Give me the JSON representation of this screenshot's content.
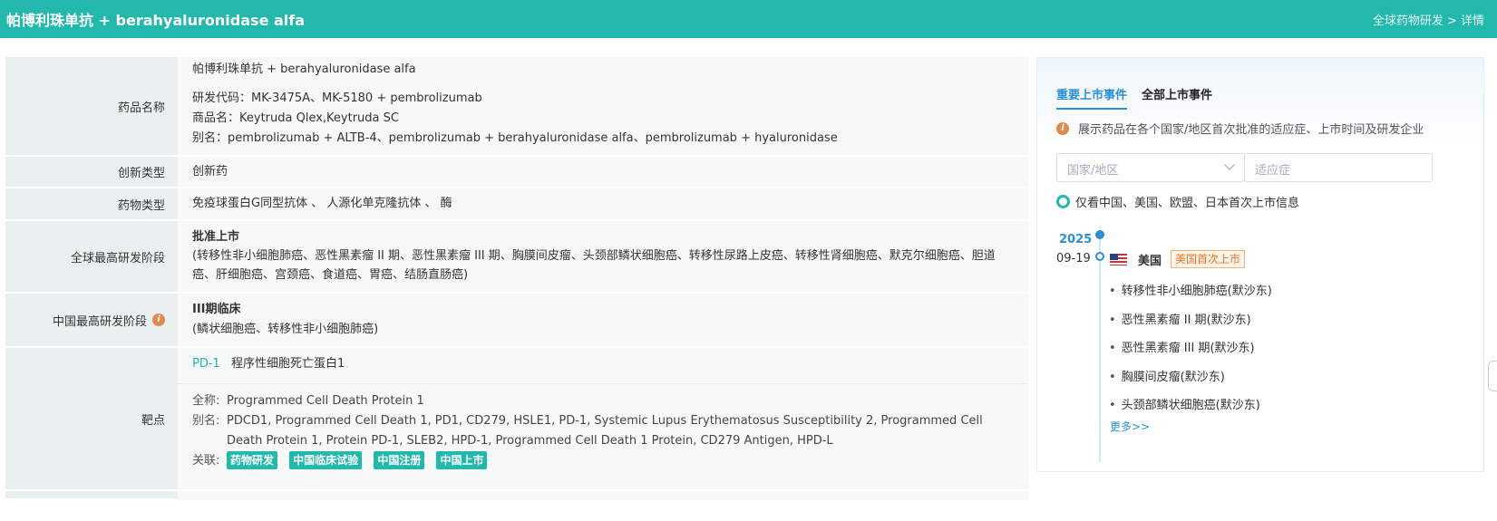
{
  "header": {
    "title": "帕博利珠单抗 + berahyaluronidase alfa",
    "breadcrumb": "全球药物研发 > 详情"
  },
  "table": {
    "drug_name": {
      "label": "药品名称",
      "name": "帕博利珠单抗 + berahyaluronidase alfa",
      "dev_code": "研发代码：MK-3475A、MK-5180 + pembrolizumab",
      "trade_name": "商品名：Keytruda Qlex,Keytruda SC",
      "alias": "别名：pembrolizumab + ALTB-4、pembrolizumab + berahyaluronidase alfa、pembrolizumab + hyaluronidase"
    },
    "innovation_type": {
      "label": "创新类型",
      "value": "创新药"
    },
    "drug_type": {
      "label": "药物类型",
      "value": "免疫球蛋白G同型抗体 、 人源化单克隆抗体 、 酶"
    },
    "global_phase": {
      "label": "全球最高研发阶段",
      "status": "批准上市",
      "indications": "(转移性非小细胞肺癌、恶性黑素瘤 II 期、恶性黑素瘤 III 期、胸膜间皮瘤、头颈部鳞状细胞癌、转移性尿路上皮癌、转移性肾细胞癌、默克尔细胞癌、胆道癌、肝细胞癌、宫颈癌、食道癌、胃癌、结肠直肠癌)"
    },
    "china_phase": {
      "label": "中国最高研发阶段",
      "status": "III期临床",
      "indications": "(鳞状细胞癌、转移性非小细胞肺癌)"
    },
    "target": {
      "label": "靶点",
      "code": "PD-1",
      "name": "程序性细胞死亡蛋白1",
      "full_label": "全称:",
      "full_name": "Programmed Cell Death Protein 1",
      "alias_label": "别名:",
      "aliases": "PDCD1, Programmed Cell Death 1, PD1, CD279, HSLE1, PD-1, Systemic Lupus Erythematosus Susceptibility 2, Programmed Cell Death Protein 1, Protein PD-1, SLEB2, HPD-1, Programmed Cell Death 1 Protein, CD279 Antigen, HPD-L",
      "related_label": "关联:",
      "tags": [
        "药物研发",
        "中国临床试验",
        "中国注册",
        "中国上市"
      ]
    }
  },
  "panel": {
    "tabs": [
      "重要上市事件",
      "全部上市事件"
    ],
    "hint": "展示药品在各个国家/地区首次批准的适应症、上市时间及研发企业",
    "country_placeholder": "国家/地区",
    "indication_placeholder": "适应症",
    "radio_label": "仅看中国、美国、欧盟、日本首次上市信息",
    "timeline": {
      "year": "2025",
      "date": "09-19",
      "country": "美国",
      "badge": "美国首次上市",
      "indications": [
        "转移性非小细胞肺癌(默沙东)",
        "恶性黑素瘤 II 期(默沙东)",
        "恶性黑素瘤 III 期(默沙东)",
        "胸膜间皮瘤(默沙东)",
        "头颈部鳞状细胞癌(默沙东)"
      ],
      "more": "更多>>"
    }
  },
  "colors": {
    "accent": "#22b8ac",
    "link": "#2a8fd6",
    "badge": "#e4742a"
  }
}
